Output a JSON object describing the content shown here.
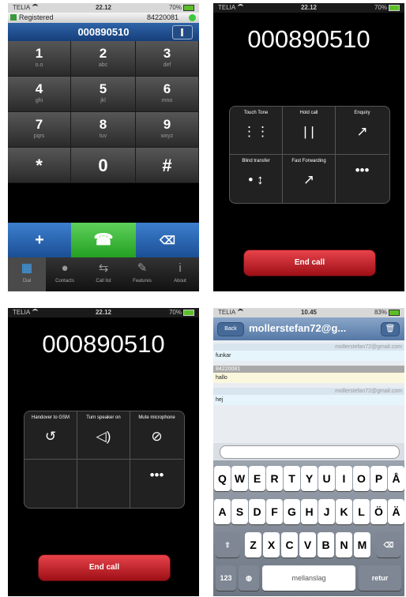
{
  "dialer": {
    "status": {
      "carrier": "TELIA",
      "time": "22.12",
      "battery": "70%"
    },
    "registration": {
      "text": "Registered",
      "number": "84220081"
    },
    "dialed_number": "000890510",
    "keys": [
      {
        "main": "1",
        "sub": "o.o"
      },
      {
        "main": "2",
        "sub": "abc"
      },
      {
        "main": "3",
        "sub": "def"
      },
      {
        "main": "4",
        "sub": "ghi"
      },
      {
        "main": "5",
        "sub": "jkl"
      },
      {
        "main": "6",
        "sub": "mno"
      },
      {
        "main": "7",
        "sub": "pqrs"
      },
      {
        "main": "8",
        "sub": "tuv"
      },
      {
        "main": "9",
        "sub": "wxyz"
      },
      {
        "main": "*",
        "sub": ""
      },
      {
        "main": "0",
        "sub": ""
      },
      {
        "main": "#",
        "sub": ""
      }
    ],
    "actions": {
      "add": "+",
      "call": "☎",
      "backspace": "⌫"
    },
    "tabs": [
      {
        "label": "Dial",
        "icon": "▦"
      },
      {
        "label": "Contacts",
        "icon": "●"
      },
      {
        "label": "Call list",
        "icon": "⇆"
      },
      {
        "label": "Features",
        "icon": "✎"
      },
      {
        "label": "About",
        "icon": "i"
      }
    ]
  },
  "call1": {
    "status": {
      "carrier": "TELIA",
      "time": "22.12",
      "battery": "70%"
    },
    "number": "000890510",
    "buttons": [
      {
        "label": "Touch Tone",
        "icon": "⋮⋮"
      },
      {
        "label": "Hold call",
        "icon": "| |"
      },
      {
        "label": "Enquiry",
        "icon": "↗"
      },
      {
        "label": "Blind transfer",
        "icon": "• ↕"
      },
      {
        "label": "Fast Forwarding",
        "icon": "↗"
      },
      {
        "label": "",
        "icon": "•••"
      }
    ],
    "end_call": "End call"
  },
  "call2": {
    "status": {
      "carrier": "TELIA",
      "time": "22.12",
      "battery": "70%"
    },
    "number": "000890510",
    "buttons": [
      {
        "label": "Handover to GSM",
        "icon": "↺"
      },
      {
        "label": "Turn speaker on",
        "icon": "◁)"
      },
      {
        "label": "Mute microphone",
        "icon": "⊘"
      },
      {
        "label": "",
        "icon": ""
      },
      {
        "label": "",
        "icon": ""
      },
      {
        "label": "",
        "icon": "•••"
      }
    ],
    "end_call": "End call"
  },
  "chat": {
    "status": {
      "carrier": "TELIA",
      "time": "10.45",
      "battery": "83%"
    },
    "back": "Back",
    "title": "mollerstefan72@g...",
    "trash": "🗑",
    "messages": [
      {
        "kind": "theirs",
        "head": "mollerstefan72@gmail.com",
        "body": "funkar"
      },
      {
        "kind": "mine",
        "head": "84220081",
        "body": "hallo"
      },
      {
        "kind": "theirs",
        "head": "mollerstefan72@gmail.com",
        "body": "hej"
      }
    ],
    "keyboard": {
      "row1": [
        "Q",
        "W",
        "E",
        "R",
        "T",
        "Y",
        "U",
        "I",
        "O",
        "P",
        "Å"
      ],
      "row2": [
        "A",
        "S",
        "D",
        "F",
        "G",
        "H",
        "J",
        "K",
        "L",
        "Ö",
        "Ä"
      ],
      "row3": [
        "Z",
        "X",
        "C",
        "V",
        "B",
        "N",
        "M"
      ],
      "shift": "⇧",
      "backspace": "⌫",
      "numbers": "123",
      "globe": "◍",
      "space": "mellanslag",
      "return": "retur"
    }
  }
}
